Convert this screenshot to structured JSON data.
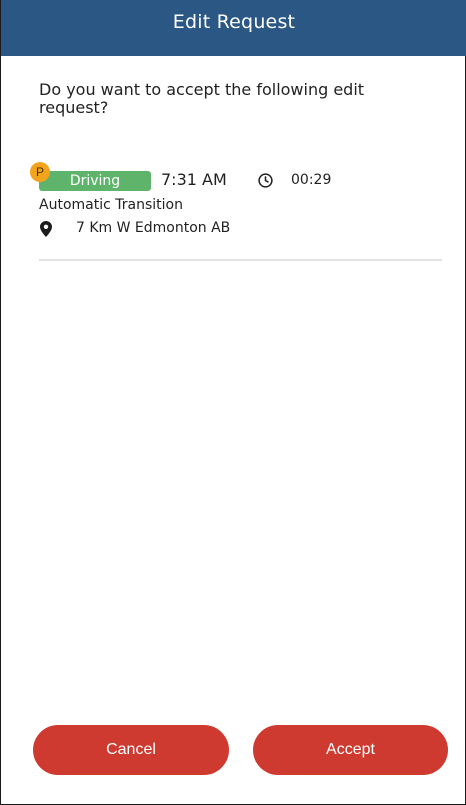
{
  "header": {
    "title": "Edit Request"
  },
  "dialog": {
    "question": "Do you want to accept the following edit request?"
  },
  "entry": {
    "badge": "P",
    "status": "Driving",
    "time": "7:31 AM",
    "duration": "00:29",
    "note": "Automatic Transition",
    "location": "7 Km W Edmonton AB",
    "status_color": "#5fb46b",
    "badge_color": "#f2a41c",
    "icons": {
      "clock": "clock-icon",
      "location": "map-pin-icon"
    }
  },
  "actions": {
    "cancel_label": "Cancel",
    "accept_label": "Accept",
    "button_color": "#cf3a30"
  },
  "theme": {
    "header_color": "#2a5783"
  }
}
